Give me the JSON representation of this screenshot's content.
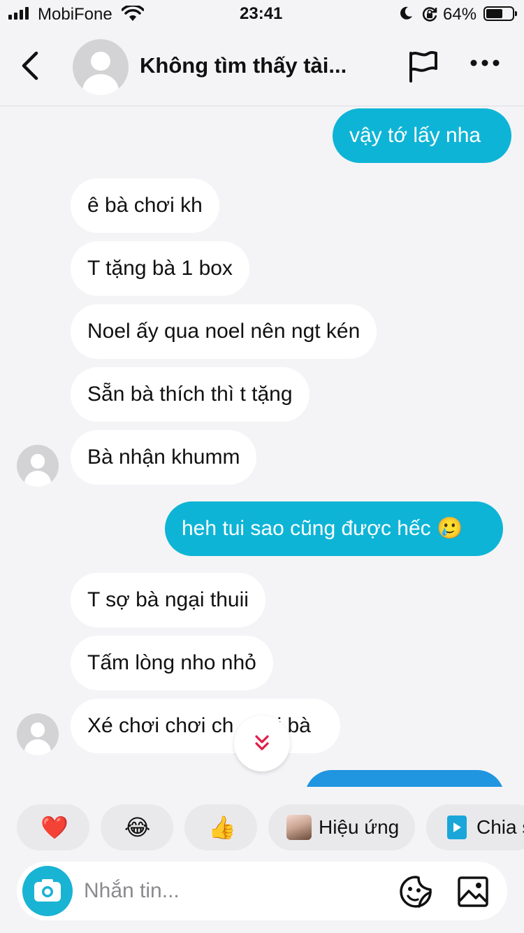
{
  "status_bar": {
    "carrier": "MobiFone",
    "time": "23:41",
    "battery": "64%",
    "battery_level": 0.64
  },
  "header": {
    "title": "Không tìm thấy tài..."
  },
  "messages": [
    {
      "side": "out",
      "text": "vậy tớ lấy nha"
    },
    {
      "side": "in",
      "text": "ê bà chơi kh"
    },
    {
      "side": "in",
      "text": "T tặng bà 1 box"
    },
    {
      "side": "in",
      "text": "Noel ấy qua noel nên ngt kén"
    },
    {
      "side": "in",
      "text": "Sẵn bà thích thì t tặng"
    },
    {
      "side": "in",
      "text": "Bà nhận khumm"
    },
    {
      "side": "out",
      "text": "heh tui sao cũng được hếc 🥲"
    },
    {
      "side": "in",
      "text": "T sợ bà ngại thuii"
    },
    {
      "side": "in",
      "text": "Tấm lòng nho nhỏ"
    },
    {
      "side": "in",
      "text": "Xé chơi chơi ch",
      "text_tail": "i bà"
    }
  ],
  "quick_replies": [
    {
      "emoji": "❤️",
      "icon": "heart"
    },
    {
      "emoji": "😂",
      "icon": "laughing-face"
    },
    {
      "emoji": "👍",
      "icon": "thumbs-up"
    },
    {
      "label": "Hiệu ứng",
      "icon": "effect-thumbnail"
    },
    {
      "label": "Chia s",
      "icon": "play-share"
    }
  ],
  "composer": {
    "placeholder": "Nhắn tin..."
  },
  "colors": {
    "outgoing_bubble": "#0eb4d6",
    "incoming_bubble": "#ffffff",
    "background": "#f4f4f6",
    "jump_arrow": "#e11d48",
    "camera": "#19b3d4"
  }
}
